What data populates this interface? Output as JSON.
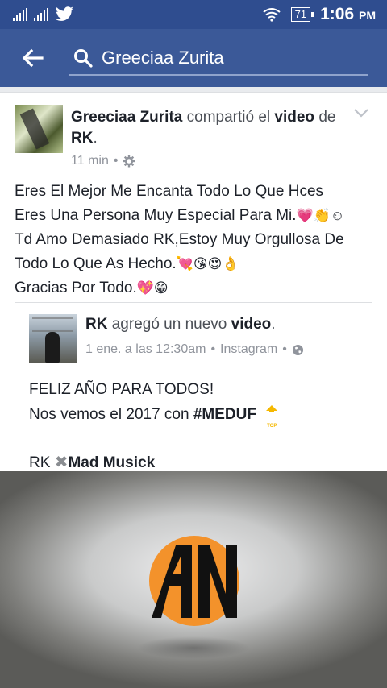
{
  "status_bar": {
    "battery": "71",
    "time": "1:06",
    "ampm": "PM"
  },
  "search": {
    "query": "Greeciaa Zurita"
  },
  "post": {
    "author": "Greeciaa Zurita",
    "action_text": "compartió el",
    "object": "video",
    "preposition": "de",
    "target": "RK",
    "time": "11 min",
    "separator": "•",
    "lines": [
      "Eres El Mejor Me Encanta Todo Lo Que Hces",
      "Eres Una Persona Muy Especial Para Mi.",
      "Td Amo Demasiado RK,Estoy Muy Orgullosa De",
      "Todo Lo Que As Hecho.",
      "Gracias Por Todo."
    ],
    "line_emojis": [
      "",
      "💗👏☺",
      "",
      "💘😘😍👌",
      "💖😁"
    ]
  },
  "shared": {
    "author": "RK",
    "action_text": "agregó un nuevo",
    "object": "video",
    "period": ".",
    "date": "1 ene. a las 12:30am",
    "separator": "•",
    "source": "Instagram",
    "text_line1": "FELIZ AÑO PARA TODOS!",
    "text_line2_prefix": "Nos vemos el 2017 con",
    "hashtag": "#MEDUF",
    "top_badge": "TOP",
    "signature_prefix": "RK",
    "signature_mark": "✖",
    "signature_name": "Mad Musick"
  },
  "video": {
    "logo_text": "AN"
  },
  "colors": {
    "fb_blue": "#3b5998",
    "status_blue": "#2f4d8f",
    "logo_orange": "#f3922b"
  },
  "icons": {
    "back": "back-arrow-icon",
    "search": "search-icon",
    "chevron": "chevron-down-icon",
    "privacy_settings": "gear-icon",
    "public": "globe-icon"
  }
}
